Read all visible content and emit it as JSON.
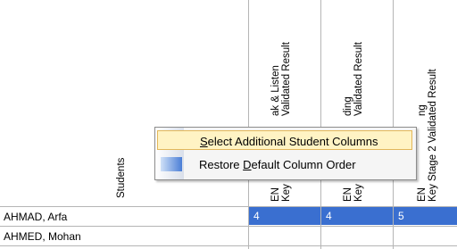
{
  "header": {
    "students_label": "Students",
    "columns": [
      {
        "line1": "ak & Listen",
        "line2": "Validated Result",
        "prefix1": "EN",
        "prefix2": "Key"
      },
      {
        "line1": "ding",
        "line2": "Validated Result",
        "prefix1": "EN",
        "prefix2": "Key"
      },
      {
        "line1": "ng",
        "line2": "Key Stage 2 Validated Result",
        "prefix1": "EN",
        "prefix2": ""
      }
    ]
  },
  "rows": [
    {
      "name": "AHMAD, Arfa",
      "values": [
        "4",
        "4",
        "5"
      ],
      "selected": true
    },
    {
      "name": "AHMED, Mohan",
      "values": [
        "",
        "",
        ""
      ],
      "selected": false
    }
  ],
  "context_menu": {
    "items": [
      {
        "pre": "",
        "accel": "S",
        "post": "elect Additional Student Columns",
        "highlighted": true
      },
      {
        "pre": "Restore ",
        "accel": "D",
        "post": "efault Column Order",
        "highlighted": false
      }
    ]
  },
  "colors": {
    "selection": "#3a6fd0",
    "menu_highlight": "#fff3c4"
  }
}
